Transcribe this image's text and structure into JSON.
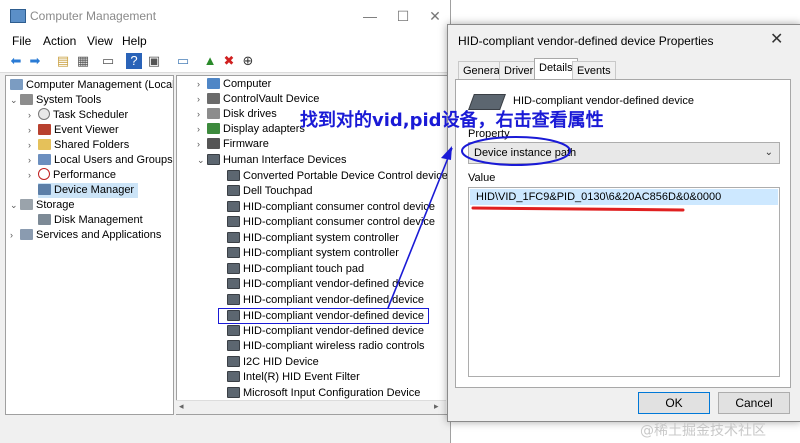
{
  "main_window": {
    "title": "Computer Management",
    "menu": [
      "File",
      "Action",
      "View",
      "Help"
    ]
  },
  "tree": [
    {
      "label": "Computer Management (Local)",
      "icon": "computer-management-icon"
    },
    {
      "label": "System Tools",
      "icon": "tools-icon"
    },
    {
      "label": "Task Scheduler",
      "icon": "clock-icon"
    },
    {
      "label": "Event Viewer",
      "icon": "event-viewer-icon"
    },
    {
      "label": "Shared Folders",
      "icon": "folder-icon"
    },
    {
      "label": "Local Users and Groups",
      "icon": "users-icon"
    },
    {
      "label": "Performance",
      "icon": "performance-icon"
    },
    {
      "label": "Device Manager",
      "icon": "device-manager-icon"
    },
    {
      "label": "Storage",
      "icon": "storage-icon"
    },
    {
      "label": "Disk Management",
      "icon": "disk-icon"
    },
    {
      "label": "Services and Applications",
      "icon": "services-icon"
    }
  ],
  "devices": {
    "categories": [
      "Computer",
      "ControlVault Device",
      "Disk drives",
      "Display adapters",
      "Firmware",
      "Human Interface Devices"
    ],
    "hid_children": [
      "Converted Portable Device Control device",
      "Dell Touchpad",
      "HID-compliant consumer control device",
      "HID-compliant consumer control device",
      "HID-compliant system controller",
      "HID-compliant system controller",
      "HID-compliant touch pad",
      "HID-compliant vendor-defined device",
      "HID-compliant vendor-defined device",
      "HID-compliant vendor-defined device",
      "HID-compliant vendor-defined device",
      "HID-compliant wireless radio controls",
      "I2C HID Device",
      "Intel(R) HID Event Filter",
      "Microsoft Input Configuration Device"
    ]
  },
  "dialog": {
    "title": "HID-compliant vendor-defined device Properties",
    "tabs": [
      "General",
      "Driver",
      "Details",
      "Events"
    ],
    "active_tab": "Details",
    "device_name": "HID-compliant vendor-defined device",
    "property_label": "Property",
    "property_value": "Device instance path",
    "value_label": "Value",
    "value": "HID\\VID_1FC9&PID_0130\\6&20AC856D&0&0000",
    "ok": "OK",
    "cancel": "Cancel"
  },
  "annotation": "找到对的vid,pid设备，右击查看属性",
  "watermark": "@稀土掘金技术社区",
  "colors": {
    "annotation": "#1a1ad6",
    "underline": "#e02020",
    "selection": "#cce4f7"
  }
}
